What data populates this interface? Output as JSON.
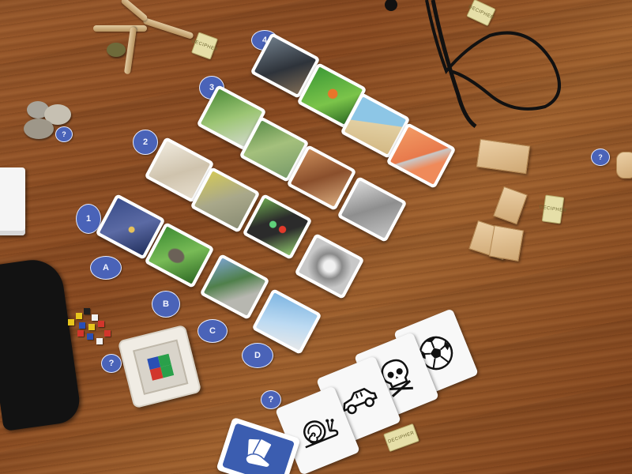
{
  "scene": {
    "surface": "wooden tabletop",
    "colors": {
      "token_blue": "#4a63b8",
      "card_white": "#ffffff",
      "felt_black": "#121212"
    }
  },
  "tokens": {
    "row_1": "1",
    "row_2": "2",
    "row_3": "3",
    "row_4": "4",
    "col_a": "A",
    "col_b": "B",
    "col_c": "C",
    "col_d": "D",
    "question_1": "?",
    "question_2": "?",
    "question_3": "?",
    "question_4": "?"
  },
  "tickets": [
    "DECIPHER",
    "DECIPHER",
    "DECIPHER",
    "DECIPHER"
  ],
  "clue_cards": [
    {
      "icon": "soccer-ball-icon"
    },
    {
      "icon": "skull-crossbones-icon"
    },
    {
      "icon": "car-crash-icon"
    },
    {
      "icon": "snail-icon"
    }
  ],
  "hand_card": {
    "icon": "hand-cards-icon",
    "color": "#3b5db0"
  }
}
